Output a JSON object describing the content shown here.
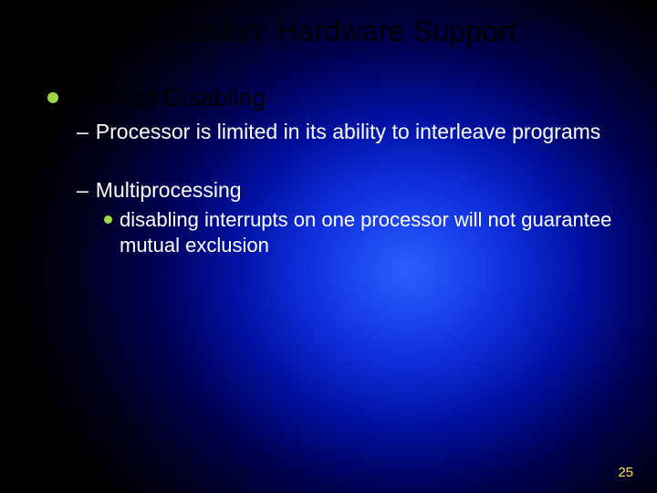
{
  "title": "Mutual Exclusion: Hardware Support",
  "lvl1": "Interrupt Disabling",
  "lvl2a": "Processor is limited in its ability to interleave programs",
  "lvl2b": "Multiprocessing",
  "lvl3": "disabling interrupts on one processor will not guarantee mutual exclusion",
  "page": "25"
}
